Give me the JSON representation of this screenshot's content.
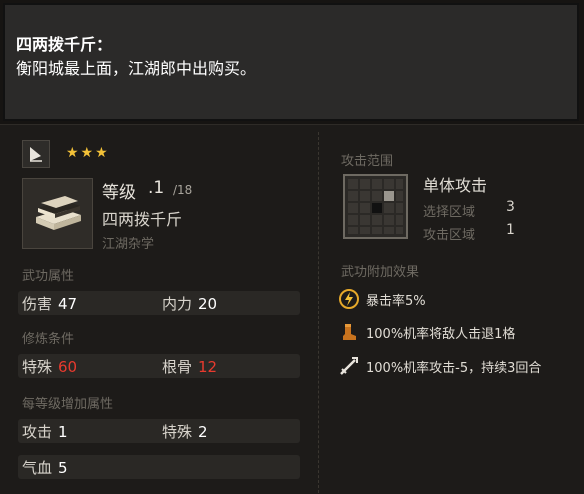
{
  "tooltip": {
    "title": "四两拨千斤：",
    "body": "衡阳城最上面，江湖郎中出购买。"
  },
  "item": {
    "type_icon": "flag-icon",
    "stars": "★★★",
    "book_icon": "book-icon",
    "level_label": "等级",
    "level_value": ".1",
    "level_max": "/18",
    "name": "四两拨千斤",
    "category": "江湖杂学"
  },
  "sections": {
    "attributes": {
      "title": "武功属性",
      "cells": [
        {
          "label": "伤害",
          "value": "47"
        },
        {
          "label": "内力",
          "value": "20"
        }
      ]
    },
    "requirements": {
      "title": "修炼条件",
      "cells": [
        {
          "label": "特殊",
          "value": "60"
        },
        {
          "label": "根骨",
          "value": "12"
        }
      ]
    },
    "per_level": {
      "title": "每等级增加属性",
      "cells": [
        {
          "label": "攻击",
          "value": "1"
        },
        {
          "label": "特殊",
          "value": "2"
        },
        {
          "label": "气血",
          "value": "5"
        }
      ]
    }
  },
  "range": {
    "title": "攻击范围",
    "target_type": "单体攻击",
    "select_label": "选择区域",
    "select_value": "3",
    "attack_label": "攻击区域",
    "attack_value": "1"
  },
  "effects": {
    "title": "武功附加效果",
    "items": [
      {
        "icon": "lightning-icon",
        "text": "暴击率5%"
      },
      {
        "icon": "boot-icon",
        "text": "100%机率将敌人击退1格"
      },
      {
        "icon": "crossed-swords-icon",
        "text": "100%机率攻击-5，持续3回合"
      }
    ]
  },
  "colors": {
    "star": "#f4c238",
    "requirement_unmet": "#e83a2e"
  }
}
